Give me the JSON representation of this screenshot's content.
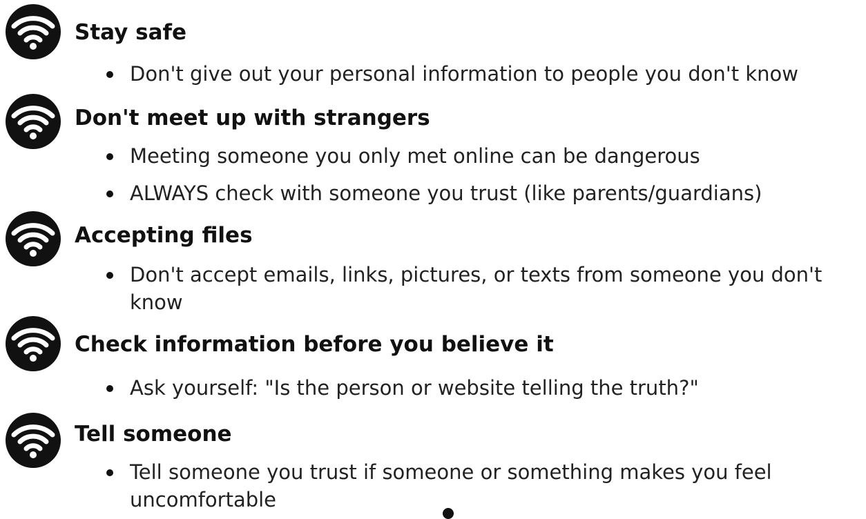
{
  "sections": [
    {
      "icon": "wifi-icon",
      "heading": "Stay safe",
      "bullets": [
        "Don't give out your personal information to people you don't know"
      ]
    },
    {
      "icon": "wifi-icon",
      "heading": "Don't meet up with strangers",
      "bullets": [
        "Meeting someone you only met online can be dangerous",
        "ALWAYS check with someone you trust (like parents/guardians)"
      ]
    },
    {
      "icon": "wifi-icon",
      "heading": "Accepting files",
      "bullets": [
        "Don't accept emails, links, pictures, or texts from someone you don't know"
      ]
    },
    {
      "icon": "wifi-icon",
      "heading": "Check information before you believe it",
      "bullets": [
        "Ask yourself: \"Is the person or website telling the truth?\""
      ]
    },
    {
      "icon": "wifi-icon",
      "heading": "Tell someone",
      "bullets": [
        "Tell someone you trust if someone or something makes you feel uncomfortable"
      ]
    }
  ],
  "colors": {
    "icon_background": "#111111",
    "icon_foreground": "#ffffff",
    "text": "#111111"
  }
}
